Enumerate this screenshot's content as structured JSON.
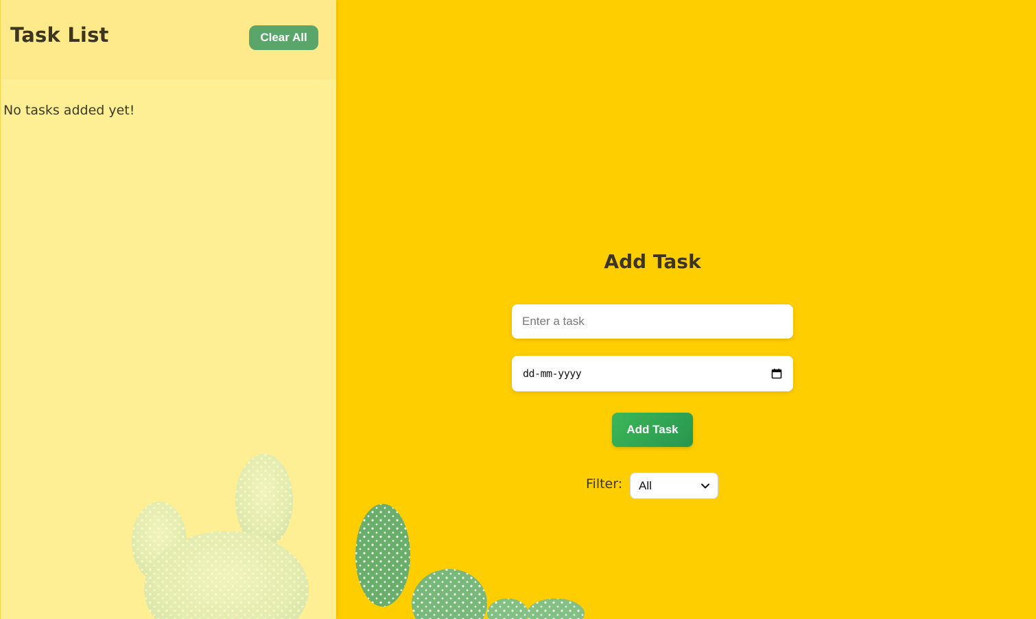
{
  "colors": {
    "background": "#ffce00",
    "sidebar_header": "#fff0aa",
    "sidebar_body": "#fff8be",
    "clear_button": "#5aa66a",
    "add_button": "#2fa752",
    "text_dark": "#3b3521"
  },
  "sidebar": {
    "title": "Task List",
    "clear_label": "Clear All",
    "empty_message": "No tasks added yet!"
  },
  "form": {
    "title": "Add Task",
    "task_input": {
      "value": "",
      "placeholder": "Enter a task"
    },
    "date_input": {
      "placeholder": "dd-mm-yyyy",
      "icon": "calendar-icon"
    },
    "add_label": "Add Task",
    "filter_label": "Filter:",
    "filter_selected": "All",
    "filter_icon": "chevron-down-icon"
  },
  "background_art": "cactus-illustration"
}
